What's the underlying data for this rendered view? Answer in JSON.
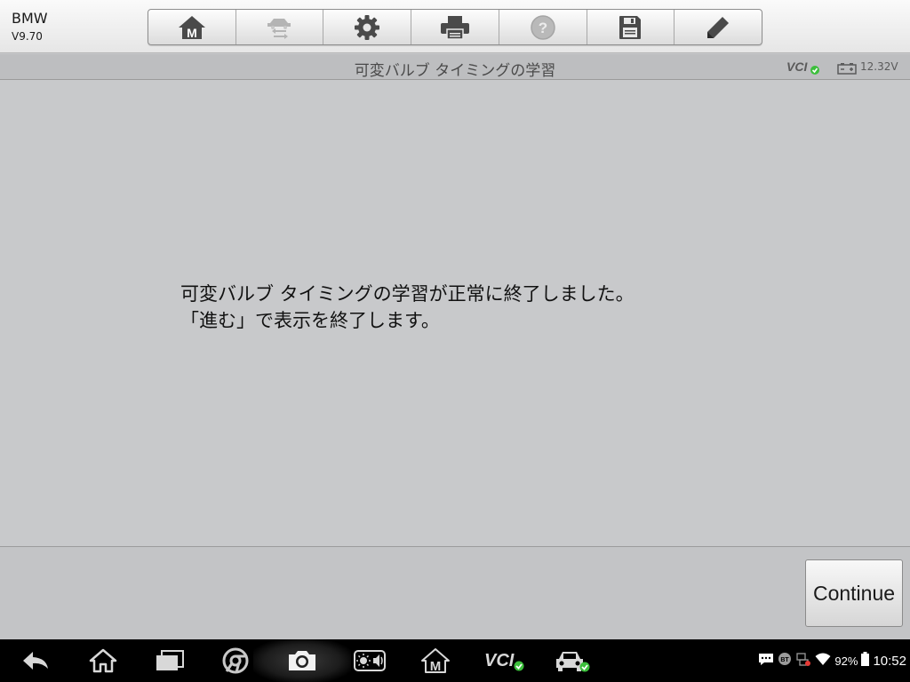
{
  "app": {
    "brand": "BMW",
    "version": "V9.70"
  },
  "toolbar": {
    "buttons": [
      {
        "name": "home-m-button",
        "icon": "home-m-icon",
        "enabled": true
      },
      {
        "name": "vehicle-swap-button",
        "icon": "vehicle-swap-icon",
        "enabled": false
      },
      {
        "name": "settings-button",
        "icon": "gear-icon",
        "enabled": true
      },
      {
        "name": "print-button",
        "icon": "printer-icon",
        "enabled": true
      },
      {
        "name": "help-button",
        "icon": "help-icon",
        "enabled": false
      },
      {
        "name": "save-button",
        "icon": "floppy-disk-icon",
        "enabled": true
      },
      {
        "name": "edit-button",
        "icon": "pencil-icon",
        "enabled": true
      }
    ]
  },
  "titlebar": {
    "title": "可変バルブ タイミングの学習",
    "vci_label": "VCI",
    "voltage": "12.32V"
  },
  "message": {
    "line1": "可変バルブ タイミングの学習が正常に終了しました。",
    "line2": "「進む」で表示を終了します。"
  },
  "footer": {
    "continue_label": "Continue"
  },
  "navbar": {
    "icons": [
      "back-icon",
      "home-icon",
      "recent-apps-icon",
      "chrome-icon",
      "camera-icon",
      "brightness-volume-icon",
      "maxisys-m-icon",
      "vci-icon",
      "car-icon"
    ],
    "vci_label": "VCI",
    "m_label": "M"
  },
  "status": {
    "battery_pct": "92%",
    "time": "10:52"
  },
  "colors": {
    "ok_green": "#3cbf3c",
    "toolbar_icon": "#4a4a4a",
    "disabled_icon": "#a9a9a9"
  }
}
